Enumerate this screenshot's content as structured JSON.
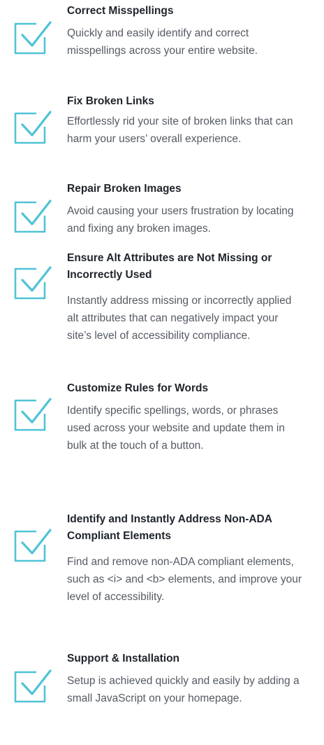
{
  "colors": {
    "icon_accent": "#4fc3d6",
    "title_text": "#20252c",
    "body_text": "#555b63",
    "background": "#ffffff"
  },
  "icon_name": "checkbox-checked-icon",
  "features": [
    {
      "title": "Correct Misspellings",
      "description": "Quickly and easily identify and correct misspellings across your entire website."
    },
    {
      "title": "Fix Broken Links",
      "description": "Effortlessly rid your site of broken links that can harm your users’ overall experience."
    },
    {
      "title": "Repair Broken Images",
      "description": "Avoid causing your users frustration by locating and fixing any broken images."
    },
    {
      "title": "Ensure Alt Attributes are Not Missing or Incorrectly Used",
      "description": "Instantly address missing or incorrectly applied alt attributes that can negatively impact your site’s level of accessibility compliance."
    },
    {
      "title": "Customize Rules for Words",
      "description": "Identify specific spellings, words, or phrases used across your website and update them in bulk at the touch of a button."
    },
    {
      "title": "Identify and Instantly Address Non-ADA Compliant Elements",
      "description": "Find and remove non-ADA compliant elements, such as <i> and <b> elements, and improve your level of accessibility."
    },
    {
      "title": "Support & Installation",
      "description": "Setup is achieved quickly and easily by adding a small JavaScript on your homepage."
    }
  ]
}
